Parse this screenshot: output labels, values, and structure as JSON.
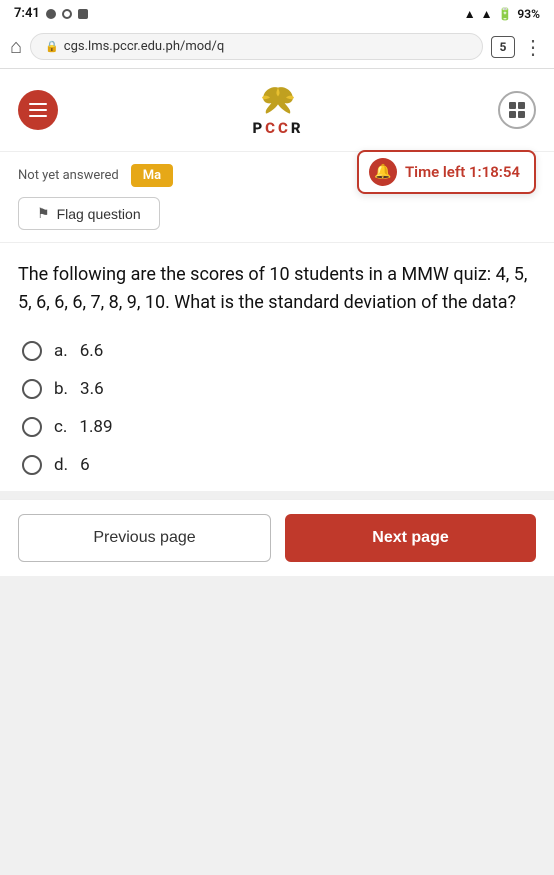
{
  "status_bar": {
    "time": "7:41",
    "battery": "93%",
    "tab_count": "5"
  },
  "browser": {
    "url": "cgs.lms.pccr.edu.ph/mod/q"
  },
  "header": {
    "logo_text": "PCCR",
    "logo_subtext": "PCCR"
  },
  "quiz": {
    "not_answered_label": "Not yet answered",
    "marks_label": "Ma",
    "timer_label": "Time left 1:18:54",
    "flag_label": "Flag question"
  },
  "question": {
    "text": "The following are the scores of 10 students in a MMW quiz: 4, 5, 5, 6, 6, 6, 7, 8, 9, 10. What is the standard deviation of the data?",
    "options": [
      {
        "letter": "a.",
        "value": "6.6"
      },
      {
        "letter": "b.",
        "value": "3.6"
      },
      {
        "letter": "c.",
        "value": "1.89"
      },
      {
        "letter": "d.",
        "value": "6"
      }
    ]
  },
  "footer": {
    "prev_label": "Previous page",
    "next_label": "Next page"
  }
}
